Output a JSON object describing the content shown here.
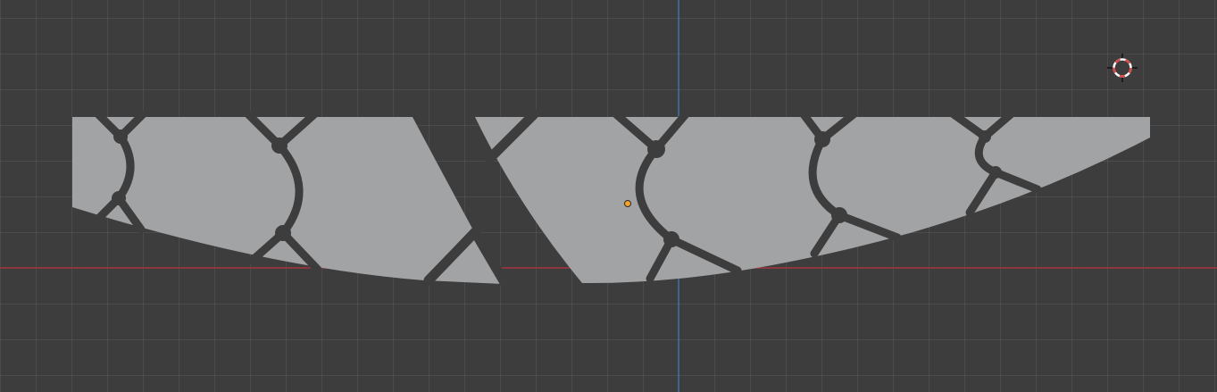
{
  "viewport": {
    "mode": "orthographic-top",
    "background_color": "#3d3d3d",
    "grid_color": "#4a4a4a",
    "x_axis_color": "#a3323c",
    "y_axis_color": "#3c6ea8",
    "mesh_fill_color": "#a2a3a5",
    "mesh_gap_color": "#3d3d3d",
    "origin_dot_color": "#f6a12a",
    "cursor_ring_colors": [
      "#d94b4b",
      "#ffffff"
    ]
  },
  "icons": {
    "cursor": "3d-cursor-icon",
    "origin": "object-origin-icon"
  },
  "objects": [
    {
      "name": "left-mesh-piece",
      "selected": false
    },
    {
      "name": "right-mesh-piece",
      "selected": false
    }
  ]
}
